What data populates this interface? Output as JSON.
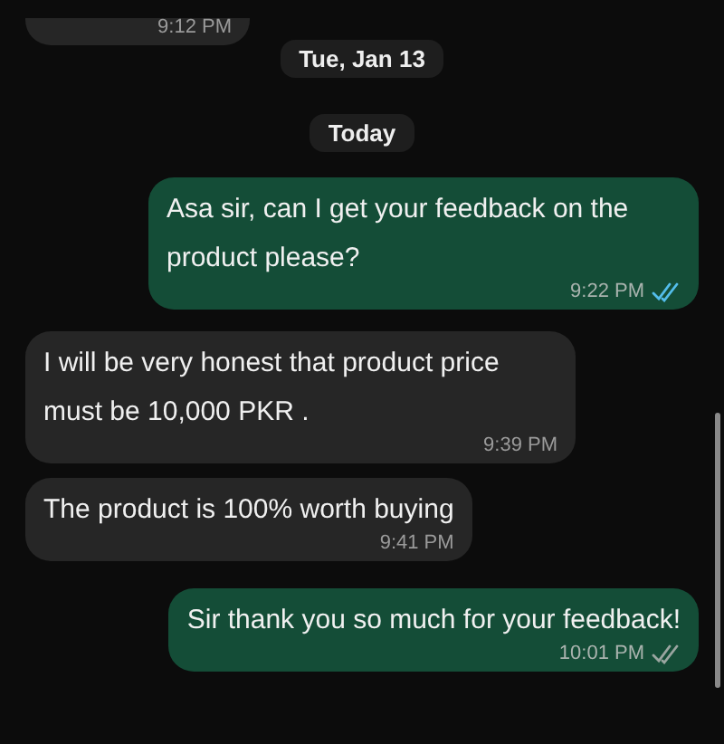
{
  "messages": [
    {
      "kind": "incoming",
      "time": "9:12 PM",
      "cut": true
    },
    {
      "kind": "date",
      "text": "Tue, Jan 13"
    },
    {
      "kind": "date",
      "text": "Today"
    },
    {
      "kind": "outgoing",
      "text": "Asa sir, can I get your feedback on the product please?",
      "time": "9:22 PM",
      "read": true
    },
    {
      "kind": "incoming",
      "text": "I will be very honest that product price must be 10,000 PKR .",
      "time": "9:39 PM"
    },
    {
      "kind": "incoming",
      "text": "The product is 100% worth buying",
      "time": "9:41 PM"
    },
    {
      "kind": "outgoing",
      "text": "Sir thank you so much for your feedback!",
      "time": "10:01 PM",
      "read": false
    }
  ]
}
